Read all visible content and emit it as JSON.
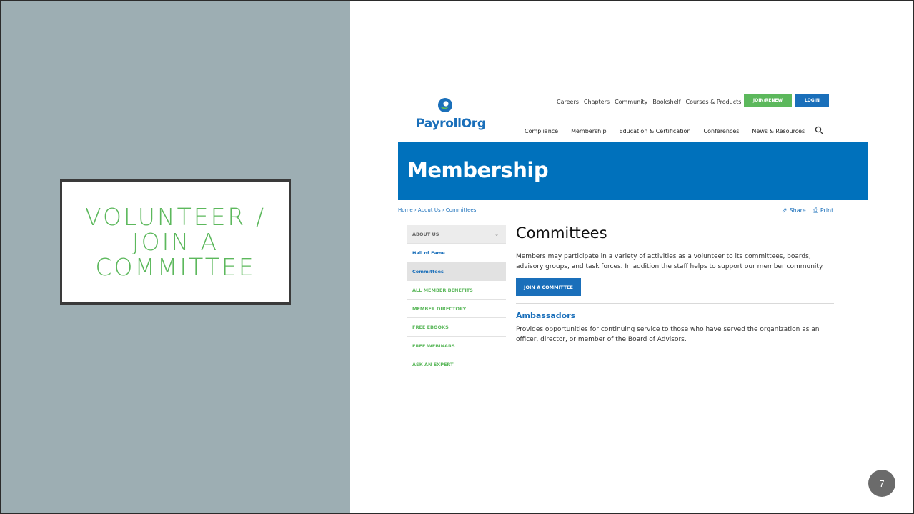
{
  "slide": {
    "title_lines": [
      "VOLUNTEER /",
      "JOIN A",
      "COMMITTEE"
    ],
    "page_number": "7"
  },
  "site": {
    "logo_text": "PayrollOrg",
    "top_links": [
      "Careers",
      "Chapters",
      "Community",
      "Bookshelf",
      "Courses & Products"
    ],
    "join_button": "JOIN/RENEW",
    "login_button": "LOGIN",
    "main_nav": [
      "Compliance",
      "Membership",
      "Education & Certification",
      "Conferences",
      "News & Resources"
    ],
    "banner_title": "Membership",
    "breadcrumb": "Home › About Us › Committees",
    "share_label": "Share",
    "print_label": "Print",
    "sidebar": {
      "header": "ABOUT US",
      "items": [
        "Hall of Fame",
        "Committees",
        "ALL MEMBER BENEFITS",
        "MEMBER DIRECTORY",
        "FREE EBOOKS",
        "FREE WEBINARS",
        "ASK AN EXPERT"
      ]
    },
    "content": {
      "heading": "Committees",
      "intro": "Members may participate in a variety of activities as a volunteer to its committees, boards, advisory groups, and task forces. In addition the staff helps to support our member community.",
      "button": "JOIN A COMMITTEE",
      "section_title": "Ambassadors",
      "section_text": "Provides opportunities for continuing service to those who have served the organization as an officer, director, or member of the Board of Advisors."
    }
  },
  "colors": {
    "left_panel": "#9daeb3",
    "title_green": "#5cb85c",
    "brand_blue": "#0071bc"
  }
}
